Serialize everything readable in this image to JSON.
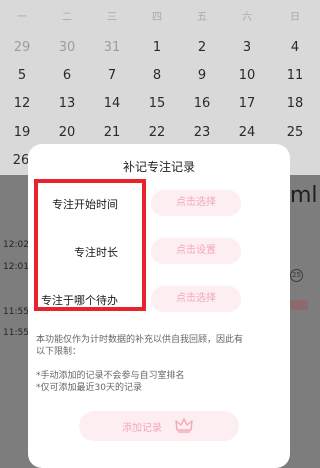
{
  "calendar": {
    "weekdays": [
      "一",
      "二",
      "三",
      "四",
      "五",
      "六",
      "日"
    ],
    "rows": [
      [
        "29",
        "30",
        "31",
        "1",
        "2",
        "3",
        "4"
      ],
      [
        "5",
        "6",
        "7",
        "8",
        "9",
        "10",
        "11"
      ],
      [
        "12",
        "13",
        "14",
        "15",
        "16",
        "17",
        "18"
      ],
      [
        "19",
        "20",
        "21",
        "22",
        "23",
        "24",
        "25"
      ],
      [
        "26"
      ]
    ]
  },
  "background": {
    "times": [
      "12:02",
      "12:01",
      "11:55",
      "11:55"
    ],
    "right_text": "ml",
    "circle_text": "25"
  },
  "modal": {
    "title": "补记专注记录",
    "rows": [
      {
        "label": "专注开始时间",
        "button": "点击选择"
      },
      {
        "label": "专注时长",
        "button": "点击设置"
      },
      {
        "label": "专注于哪个待办",
        "button": "点击选择"
      }
    ],
    "note_lines": [
      "本功能仅作为计时数据的补充以供自我回顾，因此有",
      "以下限制：",
      "",
      "*手动添加的记录不会参与自习室排名",
      "*仅可添加最近30天的记录"
    ],
    "add_button": "添加记录",
    "colors": {
      "accent": "#f4a9b8",
      "accent_bg": "#fdeef1",
      "highlight_box": "#e8232d"
    }
  }
}
